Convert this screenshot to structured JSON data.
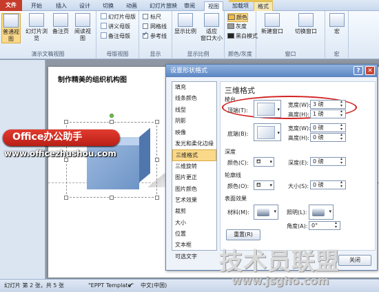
{
  "ribbon": {
    "tabs": [
      "文件",
      "开始",
      "插入",
      "设计",
      "切换",
      "动画",
      "幻灯片放映",
      "审阅",
      "视图",
      "加载项",
      "格式"
    ],
    "groups": {
      "presentation_views": {
        "name": "演示文稿视图",
        "buttons": [
          "普通视图",
          "幻灯片浏览",
          "备注页",
          "阅读视图"
        ]
      },
      "master_views": {
        "name": "母版视图",
        "items": [
          "幻灯片母版",
          "讲义母版",
          "备注母版"
        ]
      },
      "show": {
        "name": "显示",
        "checkboxes": [
          {
            "label": "标尺",
            "checked": false
          },
          {
            "label": "网格线",
            "checked": false
          },
          {
            "label": "参考线",
            "checked": true
          }
        ]
      },
      "zoom": {
        "name": "显示比例",
        "buttons": [
          "显示比例",
          "适应",
          "窗口大小"
        ]
      },
      "color": {
        "name": "颜色/灰度",
        "items": [
          {
            "label": "颜色",
            "color": "#f4b940",
            "selected": true
          },
          {
            "label": "灰度",
            "color": "#9a9a9a",
            "selected": false
          },
          {
            "label": "黑白模式",
            "color": "#222222",
            "selected": false
          }
        ]
      },
      "window": {
        "name": "窗口",
        "buttons": [
          "新建窗口",
          "切换窗口"
        ]
      },
      "macro": {
        "name": "宏",
        "buttons": [
          "宏"
        ]
      }
    }
  },
  "slide": {
    "title": "制作精美的组织机构图"
  },
  "dialog": {
    "title": "设置形状格式",
    "help_label": "?",
    "close_x": "✕",
    "categories": [
      "填充",
      "线条颜色",
      "线型",
      "阴影",
      "映像",
      "发光和柔化边缘",
      "三维格式",
      "三维旋转",
      "图片更正",
      "图片颜色",
      "艺术效果",
      "裁剪",
      "大小",
      "位置",
      "文本框",
      "可选文字"
    ],
    "selected_category": "三维格式",
    "pane_title": "三维格式",
    "bevel": {
      "section": "棱台",
      "top_label": "顶端(T):",
      "bottom_label": "底端(B):",
      "width_label": "宽度(W):",
      "height_label": "高度(H):",
      "top_width": "3 磅",
      "top_height": "1 磅",
      "bottom_width": "0 磅",
      "bottom_height": "0 磅"
    },
    "depth": {
      "section": "深度",
      "color_label": "颜色(C):",
      "depth_label": "深度(E):",
      "value": "0 磅"
    },
    "contour": {
      "section": "轮廓线",
      "color_label": "颜色(O):",
      "size_label": "大小(S):",
      "value": "0 磅"
    },
    "surface": {
      "section": "表面效果",
      "material_label": "材料(M):",
      "lighting_label": "照明(L):",
      "angle_label": "角度(A):",
      "angle_value": "0°"
    },
    "reset_label": "重置(R)",
    "close_label": "关闭"
  },
  "statusbar": {
    "slide_info": "幻灯片 第 2 张，共 5 张",
    "theme": "\"EPPT Template\"",
    "language": "中文(中国)"
  },
  "watermarks": {
    "office_badge": "Office办公助手",
    "office_url": "www.officezhushou.com",
    "site_title": "技术员联盟",
    "site_url": "www.jsgho.com"
  }
}
